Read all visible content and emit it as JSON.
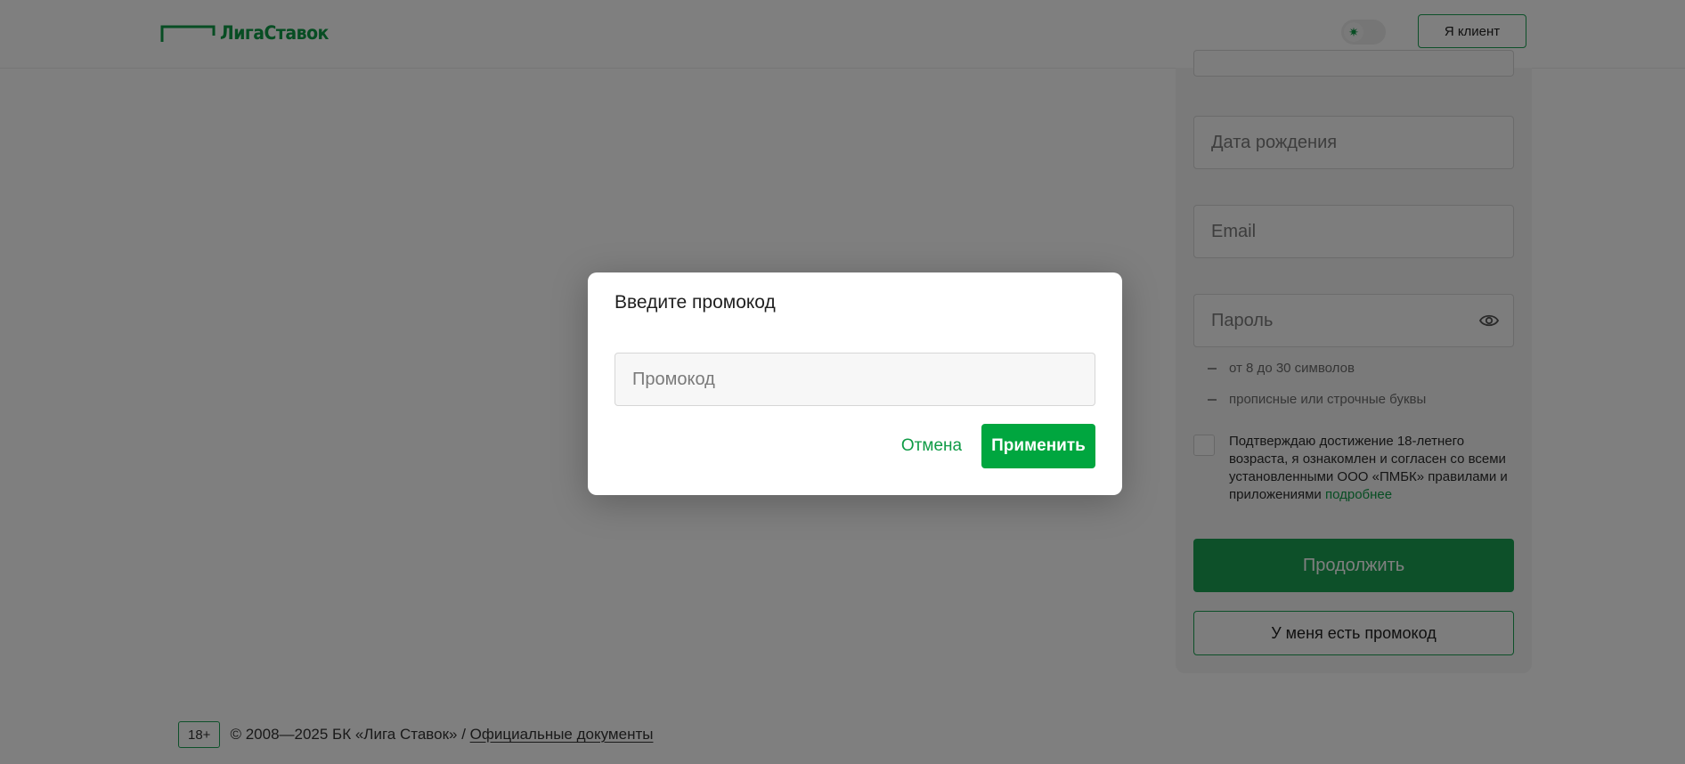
{
  "header": {
    "logo_text": "ЛигаСтавок",
    "theme_toggle_icon": "sun-icon",
    "client_button_label": "Я клиент"
  },
  "registration": {
    "birthdate_placeholder": "Дата рождения",
    "email_placeholder": "Email",
    "password_placeholder": "Пароль",
    "password_rules": [
      "от 8 до 30 символов",
      "прописные или строчные буквы"
    ],
    "consent_text": "Подтверждаю достижение 18-летнего возраста, я ознакомлен и согласен со всеми установленными ООО «ПМБК» правилами и приложениями",
    "consent_link": "подробнее",
    "continue_label": "Продолжить",
    "promo_button_label": "У меня есть промокод"
  },
  "footer": {
    "age_badge": "18+",
    "copyright": "© 2008—2025 БК «Лига Ставок» /",
    "docs_link": "Официальные документы"
  },
  "modal": {
    "title": "Введите промокод",
    "input_placeholder": "Промокод",
    "input_value": "",
    "cancel_label": "Отмена",
    "apply_label": "Применить"
  },
  "colors": {
    "brand_green": "#0f9b46",
    "button_green": "#1aa152",
    "apply_green": "#00a63f"
  }
}
